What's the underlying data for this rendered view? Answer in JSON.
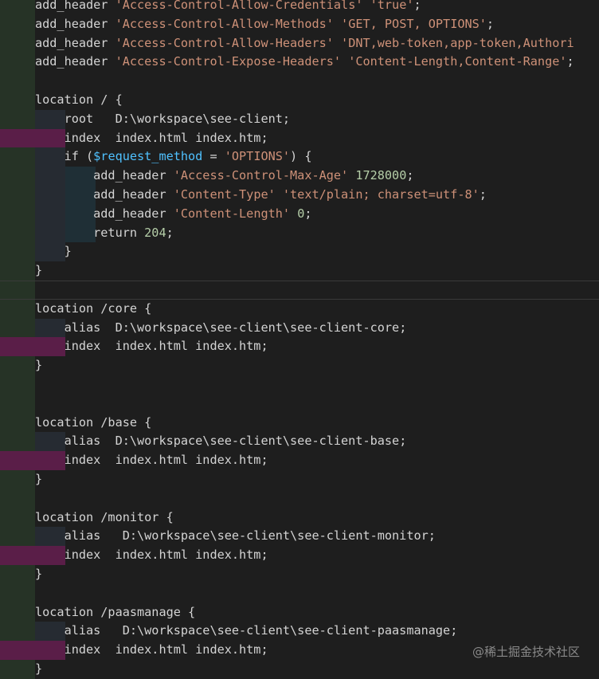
{
  "editor": {
    "lines": [
      {
        "id": "l0",
        "tokens": [
          [
            "kw",
            "add_header "
          ],
          [
            "str",
            "'Access-Control-Allow-Credentials' 'true'"
          ],
          [
            "punc",
            ";"
          ]
        ]
      },
      {
        "id": "l1",
        "tokens": [
          [
            "kw",
            "add_header "
          ],
          [
            "str",
            "'Access-Control-Allow-Methods' 'GET, POST, OPTIONS'"
          ],
          [
            "punc",
            ";"
          ]
        ]
      },
      {
        "id": "l2",
        "tokens": [
          [
            "kw",
            "add_header "
          ],
          [
            "str",
            "'Access-Control-Allow-Headers' 'DNT,web-token,app-token,Authori"
          ]
        ]
      },
      {
        "id": "l3",
        "tokens": [
          [
            "kw",
            "add_header "
          ],
          [
            "str",
            "'Access-Control-Expose-Headers' 'Content-Length,Content-Range'"
          ],
          [
            "punc",
            ";"
          ]
        ]
      },
      {
        "id": "l4",
        "tokens": []
      },
      {
        "id": "l5",
        "tokens": [
          [
            "kw",
            "location / {"
          ]
        ]
      },
      {
        "id": "l6",
        "tokens": [
          [
            "kw",
            "    root   D:\\workspace\\see-client"
          ],
          [
            "punc",
            ";"
          ]
        ]
      },
      {
        "id": "l7",
        "tokens": [
          [
            "kw",
            "    index  index.html index.htm"
          ],
          [
            "punc",
            ";"
          ]
        ]
      },
      {
        "id": "l8",
        "tokens": [
          [
            "kw",
            "    if ("
          ],
          [
            "var",
            "$request_method"
          ],
          [
            "kw",
            " = "
          ],
          [
            "str",
            "'OPTIONS'"
          ],
          [
            "kw",
            ") {"
          ]
        ]
      },
      {
        "id": "l9",
        "tokens": [
          [
            "kw",
            "        add_header "
          ],
          [
            "str",
            "'Access-Control-Max-Age'"
          ],
          [
            "kw",
            " "
          ],
          [
            "num",
            "1728000"
          ],
          [
            "punc",
            ";"
          ]
        ]
      },
      {
        "id": "l10",
        "tokens": [
          [
            "kw",
            "        add_header "
          ],
          [
            "str",
            "'Content-Type' 'text/plain; charset=utf-8'"
          ],
          [
            "punc",
            ";"
          ]
        ]
      },
      {
        "id": "l11",
        "tokens": [
          [
            "kw",
            "        add_header "
          ],
          [
            "str",
            "'Content-Length'"
          ],
          [
            "kw",
            " "
          ],
          [
            "num",
            "0"
          ],
          [
            "punc",
            ";"
          ]
        ]
      },
      {
        "id": "l12",
        "tokens": [
          [
            "kw",
            "        return "
          ],
          [
            "num",
            "204"
          ],
          [
            "punc",
            ";"
          ]
        ]
      },
      {
        "id": "l13",
        "tokens": [
          [
            "kw",
            "    }"
          ]
        ]
      },
      {
        "id": "l14",
        "tokens": [
          [
            "kw",
            "}"
          ]
        ]
      },
      {
        "id": "l15",
        "tokens": []
      },
      {
        "id": "l16",
        "tokens": [
          [
            "kw",
            "location /core {"
          ]
        ]
      },
      {
        "id": "l17",
        "tokens": [
          [
            "kw",
            "    alias  D:\\workspace\\see-client\\see-client-core"
          ],
          [
            "punc",
            ";"
          ]
        ]
      },
      {
        "id": "l18",
        "tokens": [
          [
            "kw",
            "    index  index.html index.htm"
          ],
          [
            "punc",
            ";"
          ]
        ]
      },
      {
        "id": "l19",
        "tokens": [
          [
            "kw",
            "}"
          ]
        ]
      },
      {
        "id": "l20",
        "tokens": []
      },
      {
        "id": "l21",
        "tokens": []
      },
      {
        "id": "l22",
        "tokens": [
          [
            "kw",
            "location /base {"
          ]
        ]
      },
      {
        "id": "l23",
        "tokens": [
          [
            "kw",
            "    alias  D:\\workspace\\see-client\\see-client-base"
          ],
          [
            "punc",
            ";"
          ]
        ]
      },
      {
        "id": "l24",
        "tokens": [
          [
            "kw",
            "    index  index.html index.htm"
          ],
          [
            "punc",
            ";"
          ]
        ]
      },
      {
        "id": "l25",
        "tokens": [
          [
            "kw",
            "}"
          ]
        ]
      },
      {
        "id": "l26",
        "tokens": []
      },
      {
        "id": "l27",
        "tokens": [
          [
            "kw",
            "location /monitor {"
          ]
        ]
      },
      {
        "id": "l28",
        "tokens": [
          [
            "kw",
            "    alias   D:\\workspace\\see-client\\see-client-monitor"
          ],
          [
            "punc",
            ";"
          ]
        ]
      },
      {
        "id": "l29",
        "tokens": [
          [
            "kw",
            "    index  index.html index.htm"
          ],
          [
            "punc",
            ";"
          ]
        ]
      },
      {
        "id": "l30",
        "tokens": [
          [
            "kw",
            "}"
          ]
        ]
      },
      {
        "id": "l31",
        "tokens": []
      },
      {
        "id": "l32",
        "tokens": [
          [
            "kw",
            "location /paasmanage {"
          ]
        ]
      },
      {
        "id": "l33",
        "tokens": [
          [
            "kw",
            "    alias   D:\\workspace\\see-client\\see-client-paasmanage"
          ],
          [
            "punc",
            ";"
          ]
        ]
      },
      {
        "id": "l34",
        "tokens": [
          [
            "kw",
            "    index  index.html index.htm"
          ],
          [
            "punc",
            ";"
          ]
        ]
      },
      {
        "id": "l35",
        "tokens": [
          [
            "kw",
            "}"
          ]
        ]
      }
    ]
  },
  "watermark": "@稀土掘金技术社区",
  "colors": {
    "background": "#1e1e1e",
    "text": "#d4d4d4",
    "string": "#ce9178",
    "variable": "#4fc1ff",
    "number": "#b5cea8",
    "warning_highlight": "#5a1e48"
  }
}
